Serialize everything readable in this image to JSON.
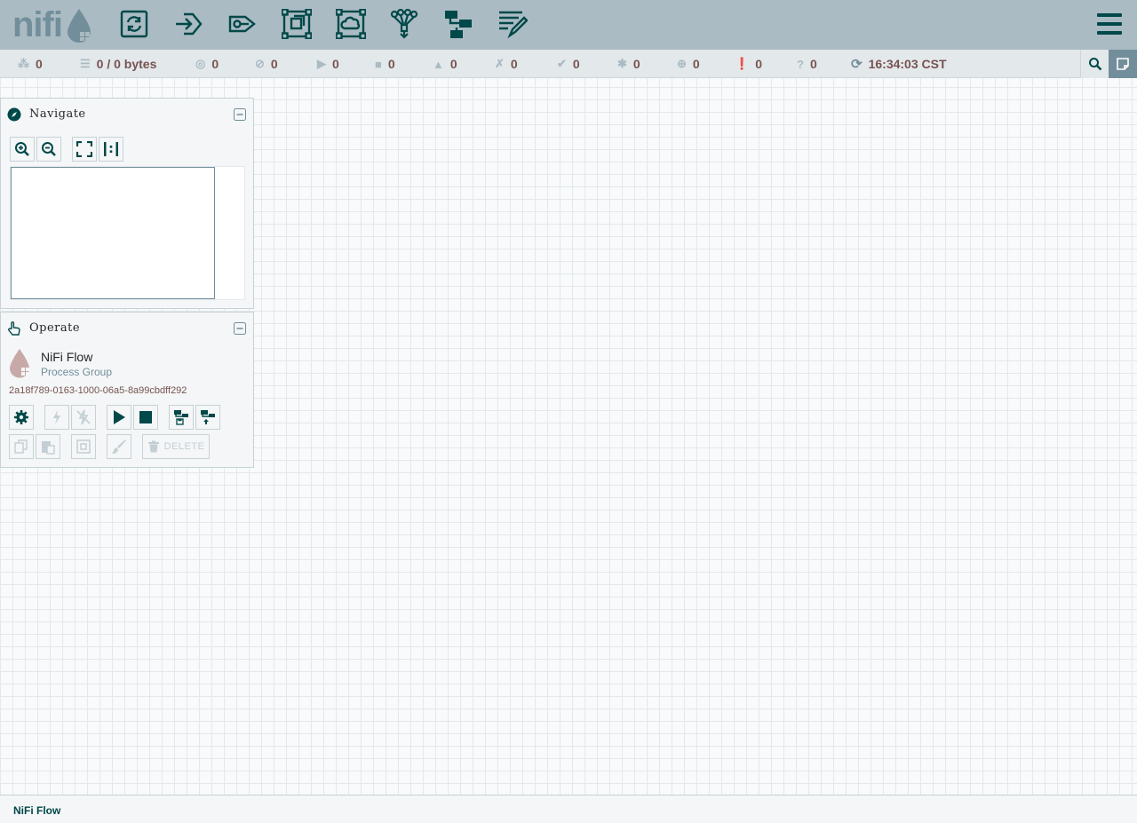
{
  "app": {
    "logo_text": "nifi"
  },
  "toolbar": {
    "items": [
      "processor",
      "input-port",
      "output-port",
      "process-group",
      "remote-process-group",
      "funnel",
      "template",
      "label"
    ]
  },
  "status": {
    "transmitting": "0",
    "queued": "0 / 0 bytes",
    "transmitting_remote": "0",
    "not_transmitting_remote": "0",
    "running": "0",
    "stopped": "0",
    "invalid": "0",
    "disabled": "0",
    "up_to_date": "0",
    "locally_modified": "0",
    "stale": "0",
    "locally_modified_stale": "0",
    "sync_failure": "0",
    "last_refreshed": "16:34:03 CST"
  },
  "navigate": {
    "title": "Navigate"
  },
  "operate": {
    "title": "Operate",
    "pg_name": "NiFi Flow",
    "pg_type": "Process Group",
    "pg_id": "2a18f789-0163-1000-06a5-8a99cbdff292",
    "delete_label": "DELETE"
  },
  "breadcrumb": {
    "label": "NiFi Flow"
  },
  "colors": {
    "header": "#aabbc3",
    "icon": "#004849",
    "accent": "#728e9b",
    "value": "#775351"
  }
}
